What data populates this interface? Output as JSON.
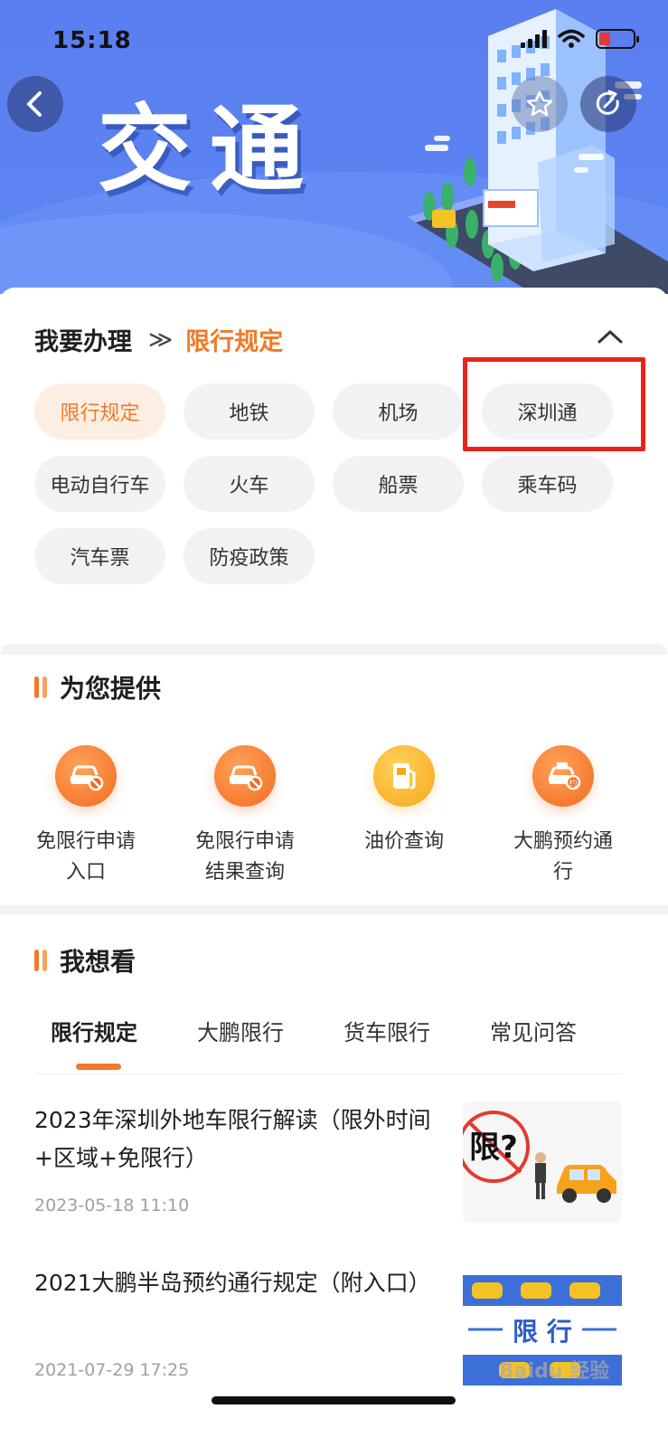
{
  "status": {
    "time": "15:18"
  },
  "header": {
    "title": "交通"
  },
  "breadcrumb": {
    "prefix": "我要办理",
    "separator": "≫",
    "current": "限行规定"
  },
  "categories": [
    {
      "label": "限行规定",
      "active": true
    },
    {
      "label": "地铁"
    },
    {
      "label": "机场"
    },
    {
      "label": "深圳通"
    },
    {
      "label": "电动自行车"
    },
    {
      "label": "火车"
    },
    {
      "label": "船票"
    },
    {
      "label": "乘车码"
    },
    {
      "label": "汽车票"
    },
    {
      "label": "防疫政策"
    }
  ],
  "services": {
    "title": "为您提供",
    "items": [
      {
        "label1": "免限行申请",
        "label2": "入口",
        "icon": "car-prohibited-icon"
      },
      {
        "label1": "免限行申请",
        "label2": "结果查询",
        "icon": "car-prohibited-icon"
      },
      {
        "label1": "油价查询",
        "label2": "",
        "icon": "fuel-pump-icon"
      },
      {
        "label1": "大鹏预约通",
        "label2": "行",
        "icon": "taxi-reserve-icon"
      }
    ]
  },
  "watch": {
    "title": "我想看",
    "tabs": [
      "限行规定",
      "大鹏限行",
      "货车限行",
      "常见问答"
    ]
  },
  "news": [
    {
      "title": "2023年深圳外地车限行解读（限外时间+区域+免限行）",
      "date": "2023-05-18 11:10",
      "thumb_text": "限?"
    },
    {
      "title": "2021大鹏半岛预约通行规定（附入口）",
      "date": "2021-07-29 17:25",
      "thumb_text": "限 行"
    }
  ],
  "watermark": "Baidu 经验"
}
